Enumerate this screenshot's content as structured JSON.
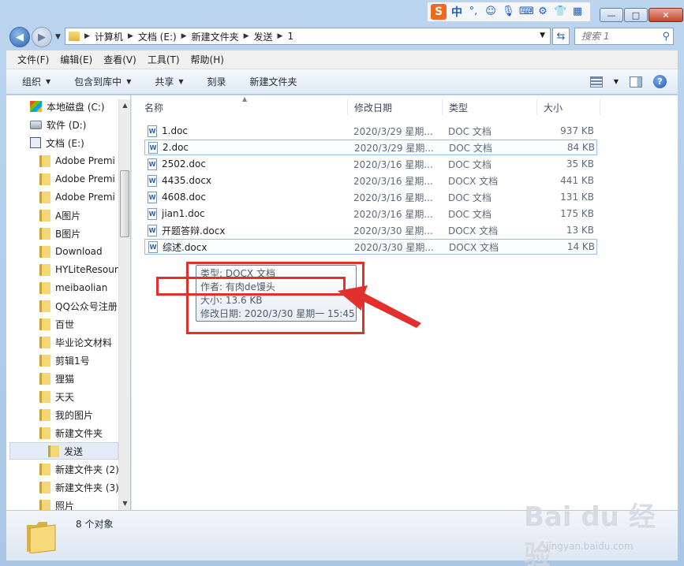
{
  "ime": {
    "logo": "S",
    "lang": "中",
    "icons": [
      "punctuation-icon",
      "emoji-icon",
      "mic-icon",
      "keyboard-icon",
      "tools-icon",
      "skin-icon",
      "grid-icon"
    ]
  },
  "window": {
    "min": "—",
    "max": "□",
    "close": "✕"
  },
  "address": {
    "crumbs": [
      "计算机",
      "文档 (E:)",
      "新建文件夹",
      "发送",
      "1"
    ],
    "search_placeholder": "搜索 1"
  },
  "menu": [
    "文件(F)",
    "编辑(E)",
    "查看(V)",
    "工具(T)",
    "帮助(H)"
  ],
  "commands": [
    {
      "label": "组织",
      "dropdown": true
    },
    {
      "label": "包含到库中",
      "dropdown": true
    },
    {
      "label": "共享",
      "dropdown": true
    },
    {
      "label": "刻录",
      "dropdown": false
    },
    {
      "label": "新建文件夹",
      "dropdown": false
    }
  ],
  "tree": [
    {
      "label": "本地磁盘 (C:)",
      "icon": "windows-drive-icon",
      "indent": 0
    },
    {
      "label": "软件 (D:)",
      "icon": "drive-icon",
      "indent": 0
    },
    {
      "label": "文档 (E:)",
      "icon": "documents-drive-icon",
      "indent": 0
    },
    {
      "label": "Adobe Premi",
      "icon": "folder-icon",
      "indent": 1
    },
    {
      "label": "Adobe Premi",
      "icon": "folder-icon",
      "indent": 1
    },
    {
      "label": "Adobe Premi",
      "icon": "folder-icon",
      "indent": 1
    },
    {
      "label": "A图片",
      "icon": "folder-icon",
      "indent": 1
    },
    {
      "label": "B图片",
      "icon": "folder-icon",
      "indent": 1
    },
    {
      "label": "Download",
      "icon": "folder-icon",
      "indent": 1
    },
    {
      "label": "HYLiteResour",
      "icon": "folder-icon",
      "indent": 1
    },
    {
      "label": "meibaolian",
      "icon": "folder-icon",
      "indent": 1
    },
    {
      "label": "QQ公众号注册",
      "icon": "folder-icon",
      "indent": 1
    },
    {
      "label": "百世",
      "icon": "folder-icon",
      "indent": 1
    },
    {
      "label": "毕业论文材料",
      "icon": "folder-icon",
      "indent": 1
    },
    {
      "label": "剪辑1号",
      "icon": "folder-icon",
      "indent": 1
    },
    {
      "label": "狸猫",
      "icon": "folder-icon",
      "indent": 1
    },
    {
      "label": "天天",
      "icon": "folder-icon",
      "indent": 1
    },
    {
      "label": "我的图片",
      "icon": "folder-icon",
      "indent": 1
    },
    {
      "label": "新建文件夹",
      "icon": "folder-icon",
      "indent": 1
    },
    {
      "label": "发送",
      "icon": "folder-icon",
      "indent": 2,
      "selected": true
    },
    {
      "label": "新建文件夹 (2)",
      "icon": "folder-icon",
      "indent": 1
    },
    {
      "label": "新建文件夹 (3)",
      "icon": "folder-icon",
      "indent": 1
    },
    {
      "label": "照片",
      "icon": "folder-icon",
      "indent": 1
    }
  ],
  "columns": [
    "名称",
    "修改日期",
    "类型",
    "大小"
  ],
  "files": [
    {
      "name": "1.doc",
      "date": "2020/3/29 星期...",
      "type": "DOC 文档",
      "size": "937 KB"
    },
    {
      "name": "2.doc",
      "date": "2020/3/29 星期...",
      "type": "DOC 文档",
      "size": "84 KB",
      "focus": true
    },
    {
      "name": "2502.doc",
      "date": "2020/3/16 星期...",
      "type": "DOC 文档",
      "size": "35 KB"
    },
    {
      "name": "4435.docx",
      "date": "2020/3/16 星期...",
      "type": "DOCX 文档",
      "size": "441 KB"
    },
    {
      "name": "4608.doc",
      "date": "2020/3/16 星期...",
      "type": "DOC 文档",
      "size": "131 KB"
    },
    {
      "name": "jian1.doc",
      "date": "2020/3/16 星期...",
      "type": "DOC 文档",
      "size": "175 KB"
    },
    {
      "name": "开题答辩.docx",
      "date": "2020/3/30 星期...",
      "type": "DOCX 文档",
      "size": "13 KB"
    },
    {
      "name": "综述.docx",
      "date": "2020/3/30 星期...",
      "type": "DOCX 文档",
      "size": "14 KB",
      "focus": true
    }
  ],
  "tooltip": {
    "type": "类型: DOCX 文档",
    "author": "作者: 有肉de馒头",
    "size": "大小: 13.6 KB",
    "modified": "修改日期: 2020/3/30 星期一 15:45"
  },
  "status": {
    "count": "8 个对象"
  },
  "watermark": {
    "text": "Bai du 经验",
    "sub": "jingyan.baidu.com"
  },
  "colors": {
    "annotation": "#e2302c",
    "accent": "#2f62ad"
  }
}
